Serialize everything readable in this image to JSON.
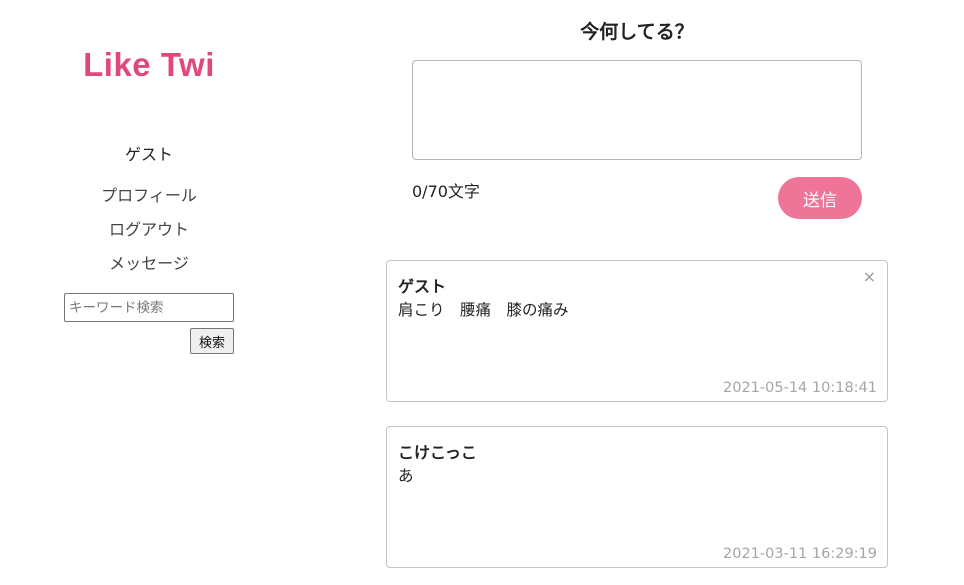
{
  "colors": {
    "brand": "#e0487a",
    "send_button": "#ef7598"
  },
  "sidebar": {
    "logo": "Like Twi",
    "username": "ゲスト",
    "nav": {
      "profile": "プロフィール",
      "logout": "ログアウト",
      "message": "メッセージ"
    },
    "search": {
      "placeholder": "キーワード検索",
      "button": "検索"
    }
  },
  "compose": {
    "heading": "今何してる？",
    "value": "",
    "counter": "0/70文字",
    "send_label": "送信"
  },
  "posts": [
    {
      "author": "ゲスト",
      "body": "肩こり　腰痛　膝の痛み",
      "timestamp": "2021-05-14 10:18:41",
      "close_icon": "×"
    },
    {
      "author": "こけこっこ",
      "body": "あ",
      "timestamp": "2021-03-11 16:29:19"
    }
  ]
}
